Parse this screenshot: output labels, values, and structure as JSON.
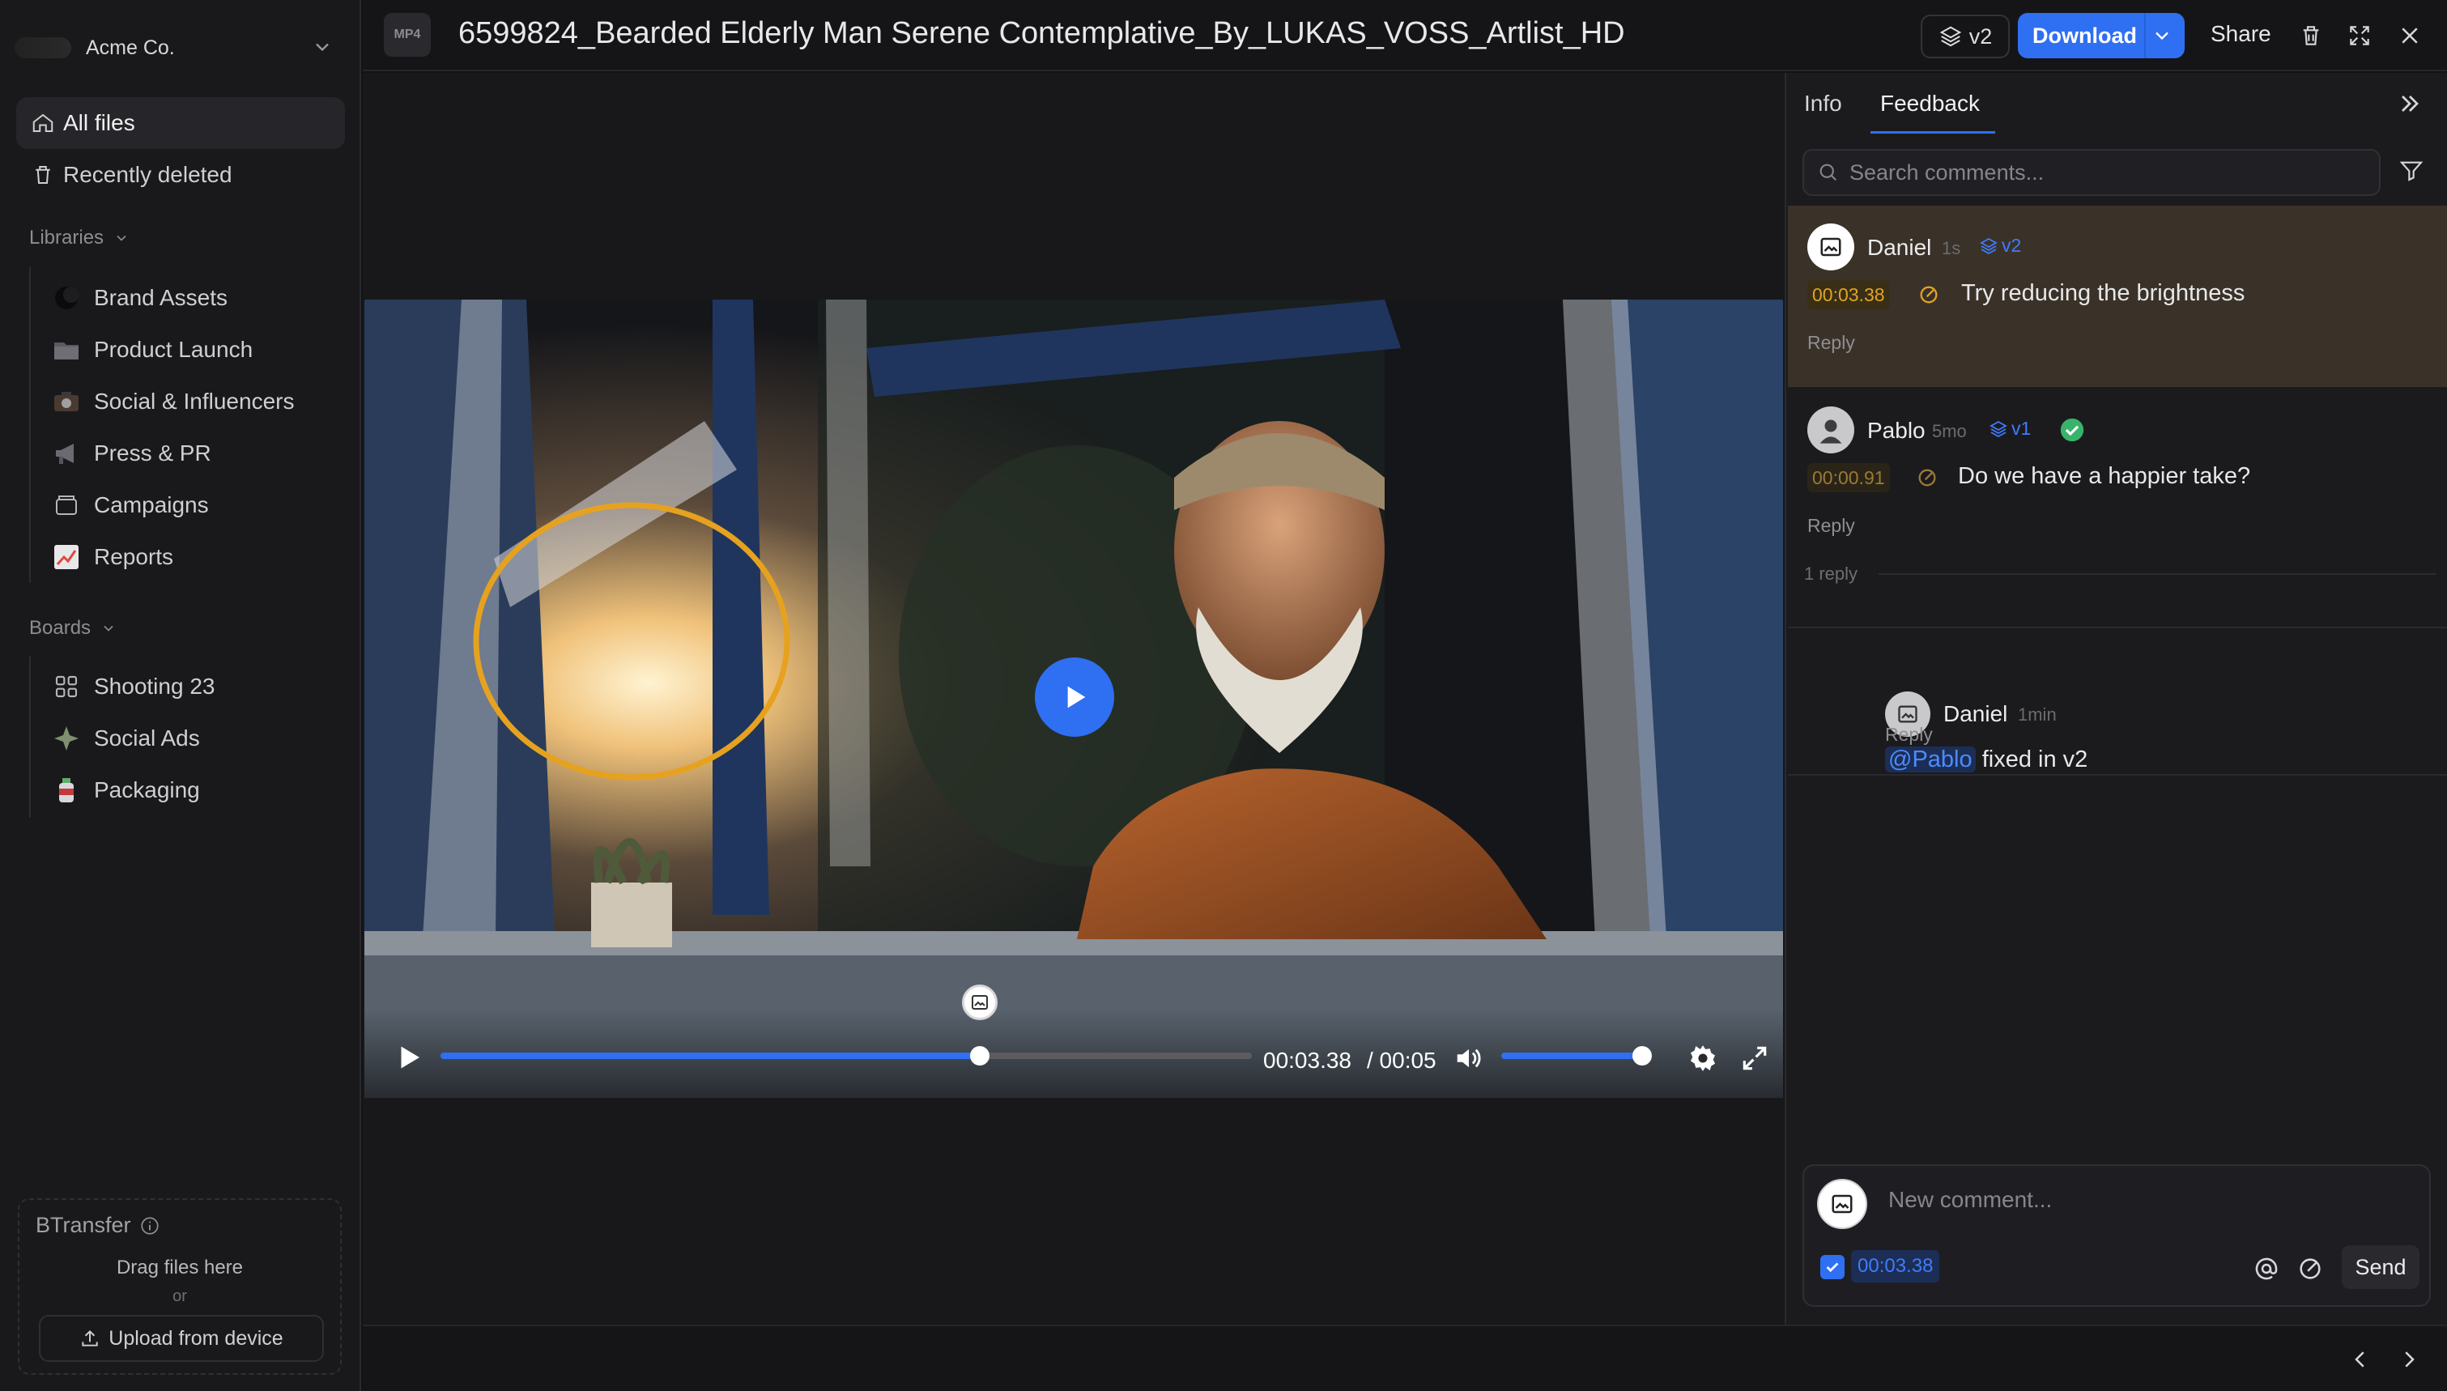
{
  "workspace": {
    "name": "Acme Co."
  },
  "nav": {
    "all_files": "All files",
    "recently_deleted": "Recently deleted"
  },
  "libraries": {
    "title": "Libraries",
    "items": [
      {
        "label": "Brand Assets",
        "icon": "moon-thumb-icon"
      },
      {
        "label": "Product Launch",
        "icon": "folder-icon"
      },
      {
        "label": "Social & Influencers",
        "icon": "camera-thumb-icon"
      },
      {
        "label": "Press & PR",
        "icon": "megaphone-icon"
      },
      {
        "label": "Campaigns",
        "icon": "box-icon"
      },
      {
        "label": "Reports",
        "icon": "chart-icon"
      }
    ]
  },
  "boards": {
    "title": "Boards",
    "items": [
      {
        "label": "Shooting 23",
        "icon": "grid-icon"
      },
      {
        "label": "Social Ads",
        "icon": "sparkle-icon"
      },
      {
        "label": "Packaging",
        "icon": "bottle-icon"
      }
    ]
  },
  "transfer": {
    "title": "BTransfer",
    "drag_text": "Drag files here",
    "or_text": "or",
    "upload_label": "Upload from device"
  },
  "topbar": {
    "file_type": "MP4",
    "file_name": "6599824_Bearded Elderly Man Serene Contemplative_By_LUKAS_VOSS_Artlist_HD",
    "version_label": "v2",
    "download_label": "Download",
    "share_label": "Share"
  },
  "player": {
    "current_time": "00:03.38",
    "duration": "/ 00:05",
    "progress_fraction": 0.665,
    "volume_fraction": 1.0
  },
  "panel": {
    "tabs": [
      "Info",
      "Feedback"
    ],
    "active_tab": "Feedback",
    "search_placeholder": "Search comments..."
  },
  "comments": [
    {
      "author": "Daniel",
      "time": "1s",
      "version": "v2",
      "timecode": "00:03.38",
      "text": "Try reducing the brightness",
      "reply_label": "Reply"
    },
    {
      "author": "Pablo",
      "time": "5mo",
      "version": "v1",
      "timecode": "00:00.91",
      "text": "Do we have a happier take?",
      "reply_label": "Reply",
      "replies_count": "1 reply"
    }
  ],
  "reply": {
    "author": "Daniel",
    "time": "1min",
    "mention": "@Pablo",
    "text": "fixed in v2",
    "reply_label": "Reply"
  },
  "new_comment": {
    "placeholder": "New comment...",
    "timecode": "00:03.38",
    "send_label": "Send"
  },
  "colors": {
    "accent": "#2f6ff2",
    "timecode": "#e0a325",
    "annotation": "#e6a21f",
    "resolved": "#39b36b"
  }
}
